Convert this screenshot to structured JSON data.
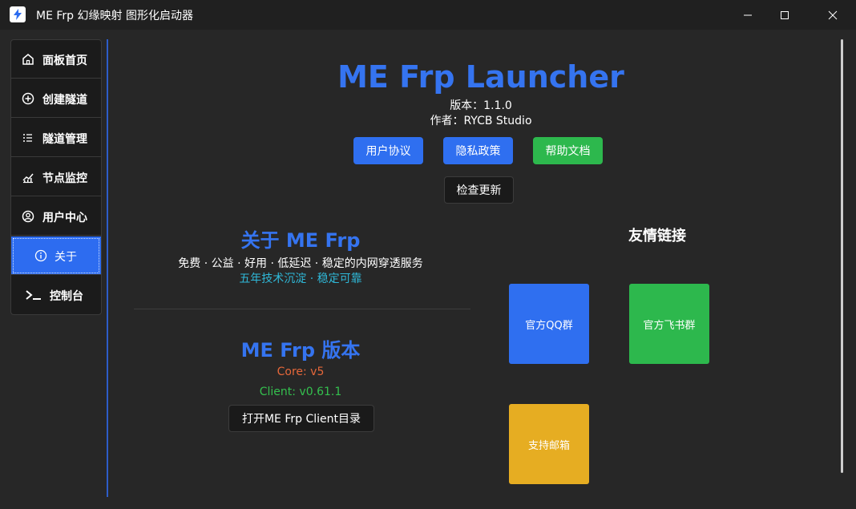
{
  "window": {
    "title": "ME Frp 幻缘映射 图形化启动器"
  },
  "sidebar": {
    "items": [
      {
        "label": "面板首页",
        "icon": "home-icon"
      },
      {
        "label": "创建隧道",
        "icon": "plus-circle-icon"
      },
      {
        "label": "隧道管理",
        "icon": "list-icon"
      },
      {
        "label": "节点监控",
        "icon": "chart-icon"
      },
      {
        "label": "用户中心",
        "icon": "user-circle-icon"
      },
      {
        "label": "关于",
        "icon": "info-icon",
        "active": true
      },
      {
        "label": "控制台",
        "icon": "terminal-icon"
      }
    ]
  },
  "header": {
    "title": "ME Frp Launcher",
    "version_line": "版本：1.1.0",
    "author_line": "作者：RYCB Studio"
  },
  "buttons": {
    "user_agreement": "用户协议",
    "privacy_policy": "隐私政策",
    "help_docs": "帮助文档",
    "check_update": "检查更新"
  },
  "about": {
    "title": "关于 ME Frp",
    "description": "免费 · 公益 · 好用 · 低延迟 · 稳定的内网穿透服务",
    "tagline": "五年技术沉淀 · 稳定可靠"
  },
  "version_section": {
    "title": "ME Frp 版本",
    "core": "Core: v5",
    "client": "Client: v0.61.1",
    "open_dir_button": "打开ME Frp Client目录"
  },
  "links": {
    "title": "友情链接",
    "qq_group": "官方QQ群",
    "feishu_group": "官方飞书群",
    "support_email": "支持邮箱"
  },
  "colors": {
    "accent_blue": "#3574f0",
    "tagline_cyan": "#2fb8d8",
    "core_orange": "#e5673a",
    "client_green": "#34c04e",
    "tile_blue": "#2f6ff0",
    "tile_green": "#2db84d",
    "tile_yellow": "#e6ad22"
  }
}
